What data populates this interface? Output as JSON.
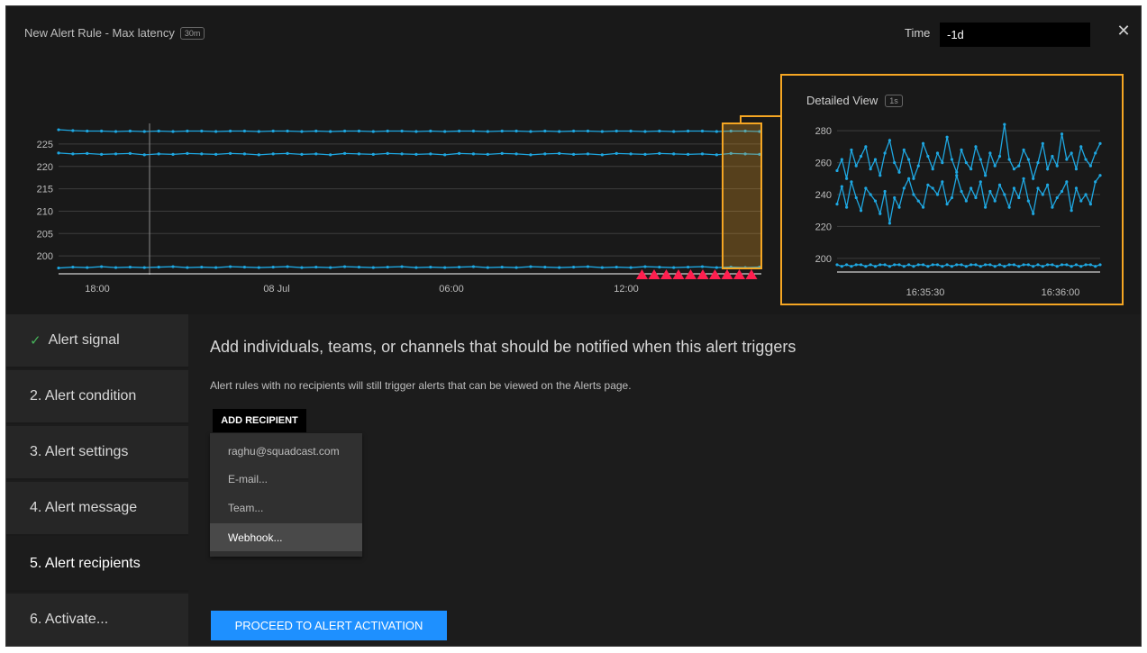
{
  "header": {
    "title": "New Alert Rule - Max latency",
    "window_badge": "30m",
    "time_label": "Time",
    "time_value": "-1d",
    "close_icon": "close-icon"
  },
  "colors": {
    "series": "#1ea7e1",
    "highlight": "#f5a623",
    "alert_marker": "#ff1f4f",
    "primary_button": "#1e90ff",
    "check": "#46b35a"
  },
  "chart_data": [
    {
      "type": "line",
      "title": "",
      "xlabel": "",
      "ylabel": "",
      "x_ticks": [
        "18:00",
        "08 Jul",
        "06:00",
        "12:00"
      ],
      "y_ticks": [
        200,
        205,
        210,
        215,
        220,
        225
      ],
      "ylim": [
        196,
        227
      ],
      "grid": true,
      "series": [
        {
          "values": [
            228.2,
            228.0,
            227.9,
            227.9,
            227.8,
            227.9,
            227.8,
            227.9,
            227.8,
            227.9,
            227.9,
            227.8,
            227.9,
            227.9,
            227.8,
            227.9,
            227.9,
            227.8,
            227.9,
            227.8,
            227.9,
            227.9,
            227.8,
            227.9,
            227.9,
            227.8,
            227.9,
            227.8,
            227.9,
            227.9,
            227.8,
            227.9,
            227.9,
            227.8,
            227.9,
            227.8,
            227.9,
            227.9,
            227.8,
            227.9,
            227.9,
            227.8,
            227.9,
            227.8,
            227.9,
            227.9,
            227.8,
            227.9,
            227.9,
            227.8
          ]
        },
        {
          "values": [
            223.0,
            222.8,
            222.9,
            222.7,
            222.8,
            222.9,
            222.6,
            222.8,
            222.7,
            222.9,
            222.8,
            222.7,
            222.9,
            222.8,
            222.6,
            222.8,
            222.9,
            222.7,
            222.8,
            222.6,
            222.9,
            222.8,
            222.7,
            222.9,
            222.8,
            222.7,
            222.8,
            222.6,
            222.9,
            222.8,
            222.7,
            222.9,
            222.8,
            222.6,
            222.8,
            222.9,
            222.7,
            222.8,
            222.6,
            222.9,
            222.8,
            222.7,
            222.9,
            222.8,
            222.7,
            222.8,
            222.6,
            222.9,
            222.8,
            222.7
          ]
        },
        {
          "values": [
            197.3,
            197.5,
            197.4,
            197.6,
            197.4,
            197.5,
            197.4,
            197.5,
            197.6,
            197.4,
            197.5,
            197.4,
            197.6,
            197.5,
            197.4,
            197.5,
            197.6,
            197.4,
            197.5,
            197.4,
            197.6,
            197.5,
            197.4,
            197.5,
            197.6,
            197.4,
            197.5,
            197.4,
            197.5,
            197.6,
            197.4,
            197.5,
            197.4,
            197.6,
            197.5,
            197.4,
            197.5,
            197.6,
            197.4,
            197.5,
            197.4,
            197.6,
            197.5,
            197.4,
            197.5,
            197.6,
            197.4,
            197.5,
            197.4,
            197.5
          ]
        }
      ],
      "alert_markers": 10
    },
    {
      "type": "line",
      "title": "Detailed View",
      "resolution_badge": "1s",
      "x_ticks": [
        "16:35:30",
        "16:36:00"
      ],
      "y_ticks": [
        200,
        220,
        240,
        260,
        280
      ],
      "ylim": [
        192,
        288
      ],
      "grid": true,
      "series": [
        {
          "values": [
            255,
            262,
            250,
            268,
            258,
            264,
            270,
            256,
            262,
            252,
            266,
            274,
            260,
            254,
            268,
            262,
            250,
            258,
            272,
            264,
            256,
            266,
            260,
            276,
            262,
            254,
            268,
            260,
            256,
            270,
            262,
            252,
            266,
            258,
            264,
            284,
            262,
            256,
            258,
            268,
            262,
            250,
            260,
            272,
            256,
            264,
            258,
            278,
            262,
            266,
            256,
            270,
            262,
            258,
            266,
            272
          ]
        },
        {
          "values": [
            234,
            245,
            232,
            248,
            238,
            230,
            244,
            240,
            236,
            228,
            242,
            222,
            238,
            232,
            244,
            250,
            240,
            236,
            232,
            246,
            244,
            240,
            248,
            234,
            238,
            252,
            242,
            236,
            244,
            238,
            248,
            232,
            242,
            236,
            246,
            240,
            232,
            244,
            238,
            250,
            236,
            228,
            244,
            240,
            246,
            232,
            238,
            242,
            248,
            230,
            244,
            236,
            240,
            234,
            248,
            252
          ]
        },
        {
          "values": [
            196,
            195,
            196,
            195,
            196,
            196,
            195,
            196,
            195,
            196,
            196,
            195,
            196,
            196,
            195,
            196,
            195,
            196,
            196,
            195,
            196,
            196,
            195,
            196,
            195,
            196,
            196,
            195,
            196,
            196,
            195,
            196,
            196,
            195,
            196,
            195,
            196,
            196,
            195,
            196,
            196,
            195,
            196,
            195,
            196,
            196,
            195,
            196,
            196,
            195,
            196,
            195,
            196,
            196,
            195,
            196
          ]
        }
      ]
    }
  ],
  "sidebar": {
    "steps": [
      {
        "label": "Alert signal",
        "completed": true
      },
      {
        "label": "2. Alert condition"
      },
      {
        "label": "3. Alert settings"
      },
      {
        "label": "4. Alert message"
      },
      {
        "label": "5. Alert recipients",
        "active": true
      },
      {
        "label": "6. Activate..."
      }
    ]
  },
  "content": {
    "heading": "Add individuals, teams, or channels that should be notified when this alert triggers",
    "subtext": "Alert rules with no recipients will still trigger alerts that can be viewed on the Alerts page.",
    "add_recipient_label": "ADD RECIPIENT",
    "menu_items": [
      "raghu@squadcast.com",
      "E-mail...",
      "Team...",
      "Webhook..."
    ],
    "highlighted_item": "Webhook...",
    "proceed_label": "PROCEED TO ALERT ACTIVATION"
  }
}
